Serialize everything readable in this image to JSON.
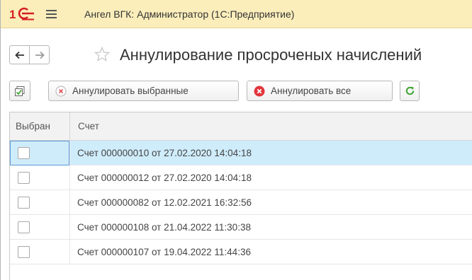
{
  "app": {
    "title": "Ангел ВГК: Администратор  (1С:Предприятие)",
    "logo_icon": "1c-logo-icon",
    "menu_icon": "hamburger-menu-icon"
  },
  "header": {
    "back_icon": "arrow-left-icon",
    "forward_icon": "arrow-right-icon",
    "favorite_icon": "star-outline-icon",
    "page_title": "Аннулирование просроченых начислений"
  },
  "toolbar": {
    "check_icon": "checklist-icon",
    "annul_selected_label": "Аннулировать выбранные",
    "annul_all_label": "Аннулировать все",
    "refresh_icon": "refresh-icon"
  },
  "table": {
    "columns": [
      "Выбран",
      "Счет"
    ],
    "rows": [
      {
        "selected": false,
        "account": "Счет 000000010 от 27.02.2020 14:04:18"
      },
      {
        "selected": false,
        "account": "Счет 000000012 от 27.02.2020 14:04:18"
      },
      {
        "selected": false,
        "account": "Счет 000000082 от 12.02.2021 16:32:56"
      },
      {
        "selected": false,
        "account": "Счет 000000108 от 21.04.2022 11:30:38"
      },
      {
        "selected": false,
        "account": "Счет 000000107 от 19.04.2022 11:44:36"
      }
    ],
    "highlighted_row": 0
  },
  "colors": {
    "titlebar_bg": "#fbeebb",
    "logo_red": "#d51f26",
    "selected_row_bg": "#cfecfb",
    "refresh_green": "#3fa535",
    "delete_red": "#e3343b"
  }
}
